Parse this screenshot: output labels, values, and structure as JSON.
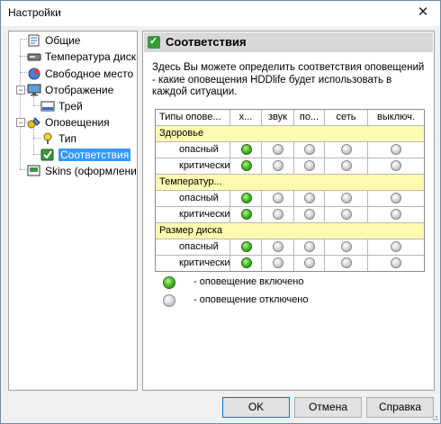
{
  "window": {
    "title": "Настройки",
    "close_label": "✕"
  },
  "tree": {
    "items": [
      {
        "label": "Общие",
        "icon": "general-settings-icon"
      },
      {
        "label": "Температура диска",
        "icon": "disk-temperature-icon"
      },
      {
        "label": "Свободное место",
        "icon": "free-space-icon"
      },
      {
        "label": "Отображение",
        "icon": "display-icon"
      },
      {
        "label": "Трей",
        "icon": "tray-icon"
      },
      {
        "label": "Оповещения",
        "icon": "notifications-icon"
      },
      {
        "label": "Тип",
        "icon": "type-icon"
      },
      {
        "label": "Соответствия",
        "icon": "mapping-icon",
        "selected": true
      },
      {
        "label": "Skins (оформление)",
        "icon": "skins-icon"
      }
    ]
  },
  "panel": {
    "title": "Соответствия",
    "description": "Здесь Вы можете определить соответствия оповещений - какие оповещения HDDlife будет использовать в каждой ситуации."
  },
  "table": {
    "headers": [
      "Типы опове...",
      "х...",
      "звук",
      "по...",
      "сеть",
      "выключ."
    ],
    "groups": [
      {
        "name": "Здоровье",
        "rows": [
          {
            "label": "опасный",
            "states": [
              true,
              false,
              false,
              false,
              false
            ]
          },
          {
            "label": "критический",
            "states": [
              true,
              false,
              false,
              false,
              false
            ]
          }
        ]
      },
      {
        "name": "Температур...",
        "rows": [
          {
            "label": "опасный",
            "states": [
              true,
              false,
              false,
              false,
              false
            ]
          },
          {
            "label": "критический",
            "states": [
              true,
              false,
              false,
              false,
              false
            ]
          }
        ]
      },
      {
        "name": "Размер диска",
        "rows": [
          {
            "label": "опасный",
            "states": [
              true,
              false,
              false,
              false,
              false
            ]
          },
          {
            "label": "критический",
            "states": [
              true,
              false,
              false,
              false,
              false
            ]
          }
        ]
      }
    ]
  },
  "legend": {
    "on": "- оповещение включено",
    "off": "- оповещение отключено"
  },
  "buttons": {
    "ok": "OK",
    "cancel": "Отмена",
    "help": "Справка"
  },
  "colors": {
    "group_bg": "#fffbb0",
    "selection": "#3399ff",
    "lamp_on": "#4fbf2a",
    "lamp_off": "#d6d6d6"
  }
}
